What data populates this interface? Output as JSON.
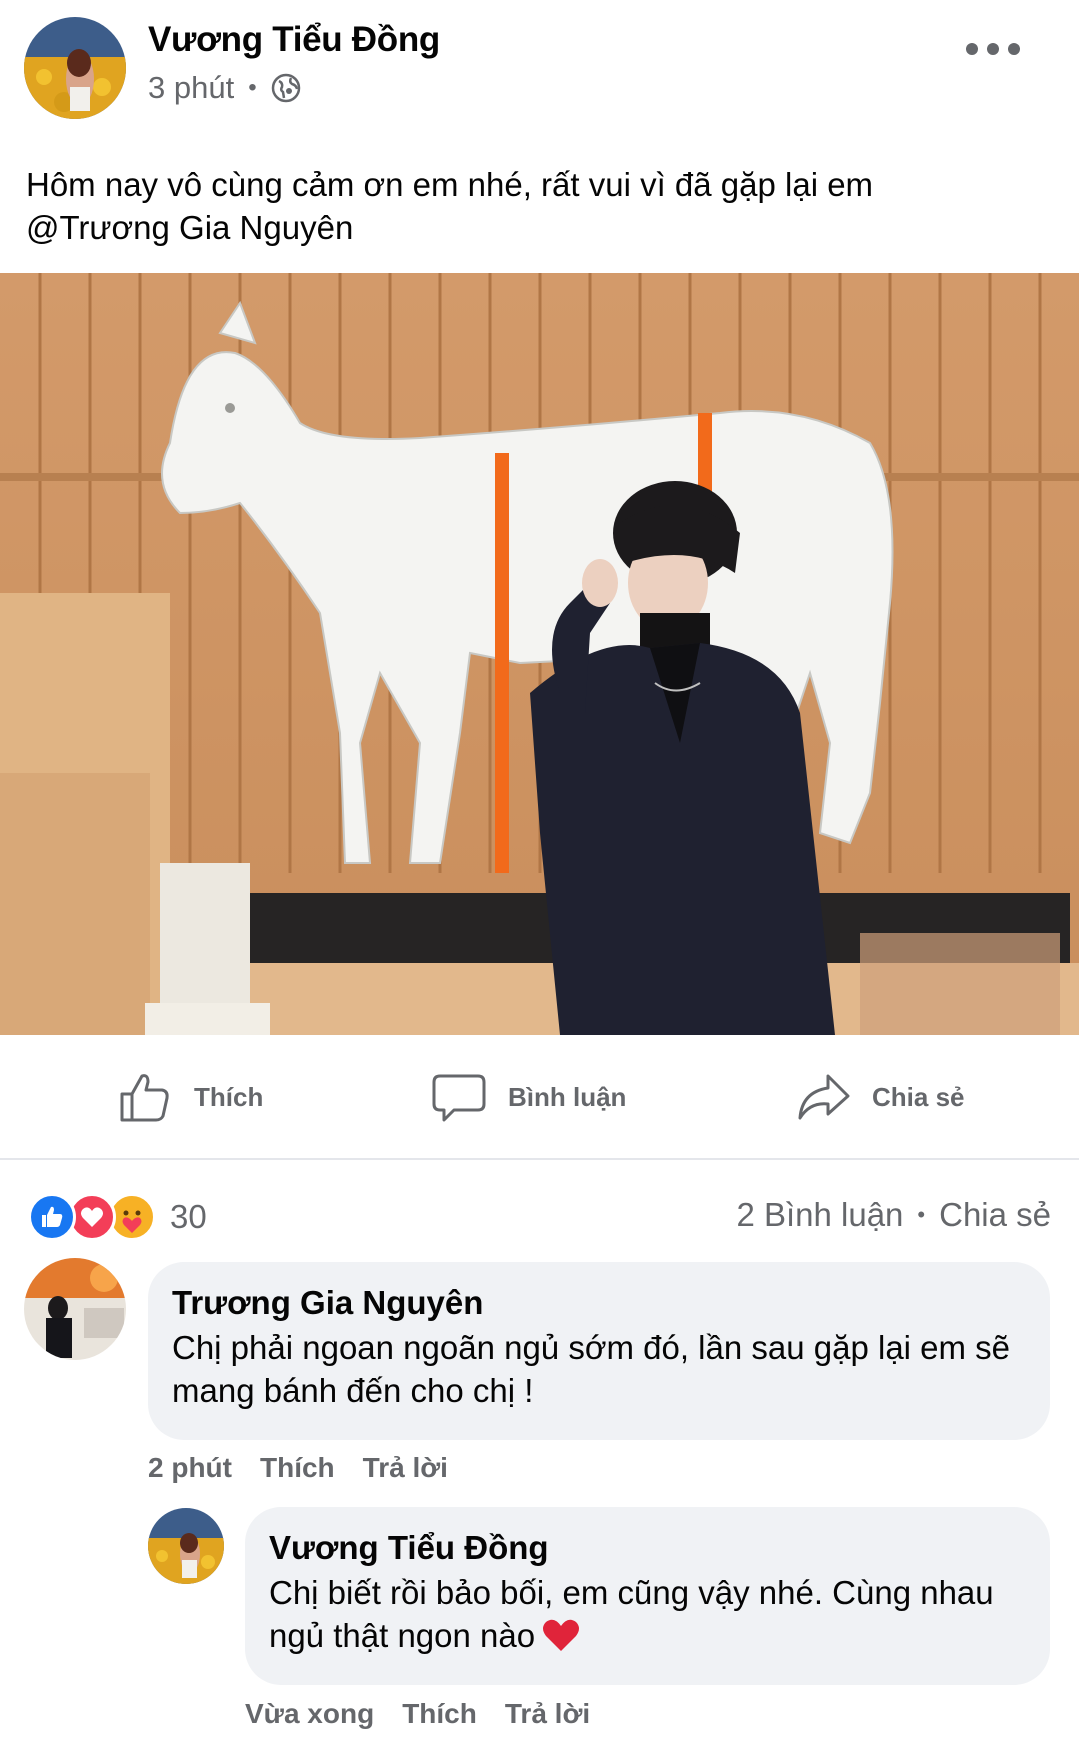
{
  "post": {
    "author": "Vương Tiểu Đồng",
    "time": "3 phút",
    "text_line1": "Hôm nay vô cùng cảm ơn em nhé, rất vui vì đã gặp lại em",
    "text_line2": "@Trương Gia Nguyên"
  },
  "actions": {
    "like": "Thích",
    "comment": "Bình luận",
    "share": "Chia sẻ"
  },
  "stats": {
    "reaction_count": "30",
    "comments": "2  Bình luận",
    "shares": "Chia sẻ"
  },
  "comments": [
    {
      "name": "Trương Gia Nguyên",
      "line1": "Chị phải ngoan ngoãn ngủ sớm đó, lần sau gặp lại em sẽ",
      "line2": "mang bánh đến cho chị !",
      "time": "2 phút",
      "like": "Thích",
      "reply": "Trả lời"
    },
    {
      "name": "Vương Tiểu Đồng",
      "line1": "Chị biết rồi bảo bối, em cũng vậy nhé. Cùng nhau",
      "line2": "ngủ thật ngon nào",
      "time": "Vừa xong",
      "like": "Thích",
      "reply": "Trả lời"
    }
  ],
  "icons": {
    "more": "more-icon",
    "globe": "globe-icon",
    "like": "thumbs-up-icon",
    "comment": "comment-bubble-icon",
    "share": "share-arrow-icon",
    "reaction_like": "like-reaction-icon",
    "reaction_love": "love-reaction-icon",
    "reaction_care": "care-reaction-icon",
    "heart_emoji": "heart-icon"
  },
  "colors": {
    "text": "#050505",
    "secondary": "#65676b",
    "bubble": "#f0f2f5",
    "like_blue": "#1877f2",
    "love_red": "#f33e58",
    "care_yellow": "#f7b125"
  }
}
